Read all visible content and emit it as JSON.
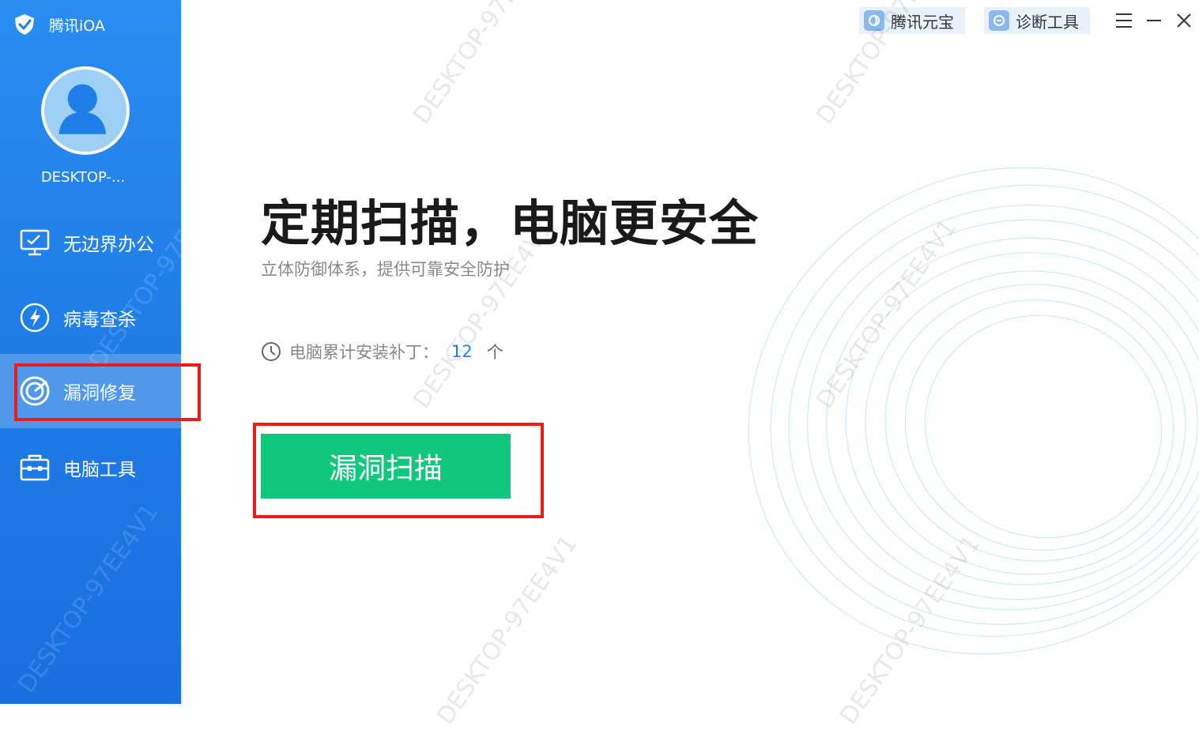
{
  "app": {
    "name": "腾讯iOA"
  },
  "user": {
    "device_name": "DESKTOP-..."
  },
  "sidebar": {
    "items": [
      {
        "label": "无边界办公",
        "icon": "monitor-icon",
        "active": false
      },
      {
        "label": "病毒查杀",
        "icon": "lightning-icon",
        "active": false
      },
      {
        "label": "漏洞修复",
        "icon": "target-icon",
        "active": true
      },
      {
        "label": "电脑工具",
        "icon": "toolbox-icon",
        "active": false
      }
    ]
  },
  "toolbar": {
    "yuanbao_label": "腾讯元宝",
    "diagnose_label": "诊断工具"
  },
  "main": {
    "headline": "定期扫描，电脑更安全",
    "subline": "立体防御体系，提供可靠安全防护",
    "patch_label": "电脑累计安装补丁：",
    "patch_count": "12",
    "patch_unit": "个",
    "scan_button": "漏洞扫描"
  },
  "watermark": "DESKTOP-97EE4V1",
  "colors": {
    "sidebar": "#1f7ee8",
    "accent": "#10c87c",
    "highlight": "#ee1b1b",
    "link": "#1e86f0"
  }
}
